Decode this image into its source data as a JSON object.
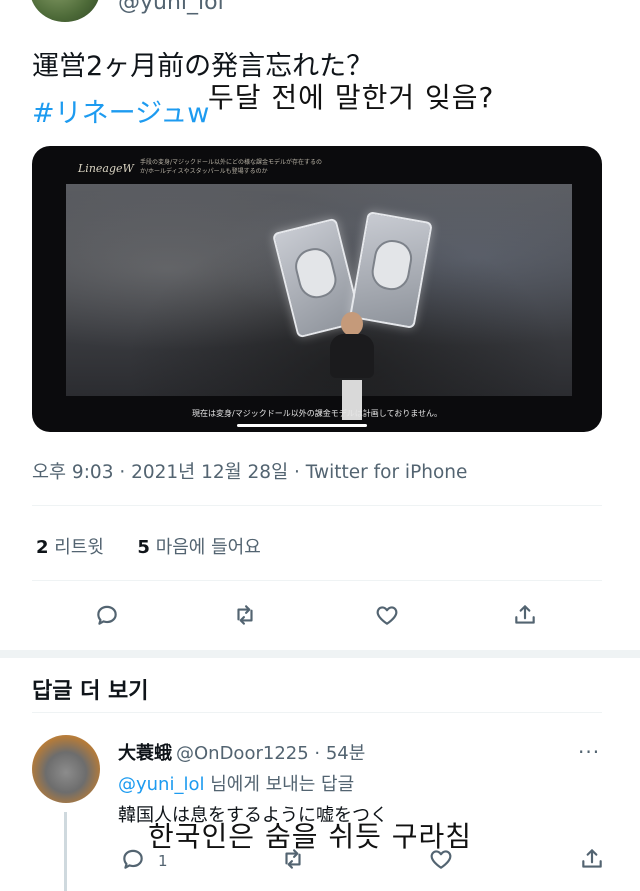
{
  "author": {
    "handle": "@yuni_lol"
  },
  "tweet": {
    "text": "運営2ヶ月前の発言忘れた？",
    "hashtag": "#リネージュw",
    "overlay_translation": "두달 전에 말한거 잊음?",
    "media": {
      "logo": "LineageW",
      "caption_top": "手段の変身/マジックドール以外にどの様な課金モデルが存在するのか/ホールディスやスタッパールも登場するのか",
      "subtitle": "現在は変身/マジックドール以外の課金モデルは計画しておりません。"
    },
    "meta": "오후 9:03 · 2021년 12월 28일 · Twitter for iPhone",
    "stats": {
      "retweets_count": "2",
      "retweets_label": "리트윗",
      "likes_count": "5",
      "likes_label": "마음에 들어요"
    },
    "actions": [
      "reply-icon",
      "retweet-icon",
      "like-icon",
      "share-icon"
    ]
  },
  "replies_section": {
    "title": "답글 더 보기"
  },
  "reply": {
    "name": "大蓑蛾",
    "handle_time": "@OnDoor1225 · 54분",
    "more": "···",
    "reply_to_mention": "@yuni_lol",
    "reply_to_suffix": " 님에게 보내는 답글",
    "text": "韓国人は息をするように嘘をつく",
    "overlay_translation": "한국인은 숨을 쉬듯 구라침",
    "reply_count": "1",
    "actions": [
      "reply-icon",
      "retweet-icon",
      "like-icon",
      "share-icon"
    ]
  },
  "colors": {
    "accent": "#1d9bf0",
    "muted": "#536471",
    "text": "#0f1419"
  }
}
